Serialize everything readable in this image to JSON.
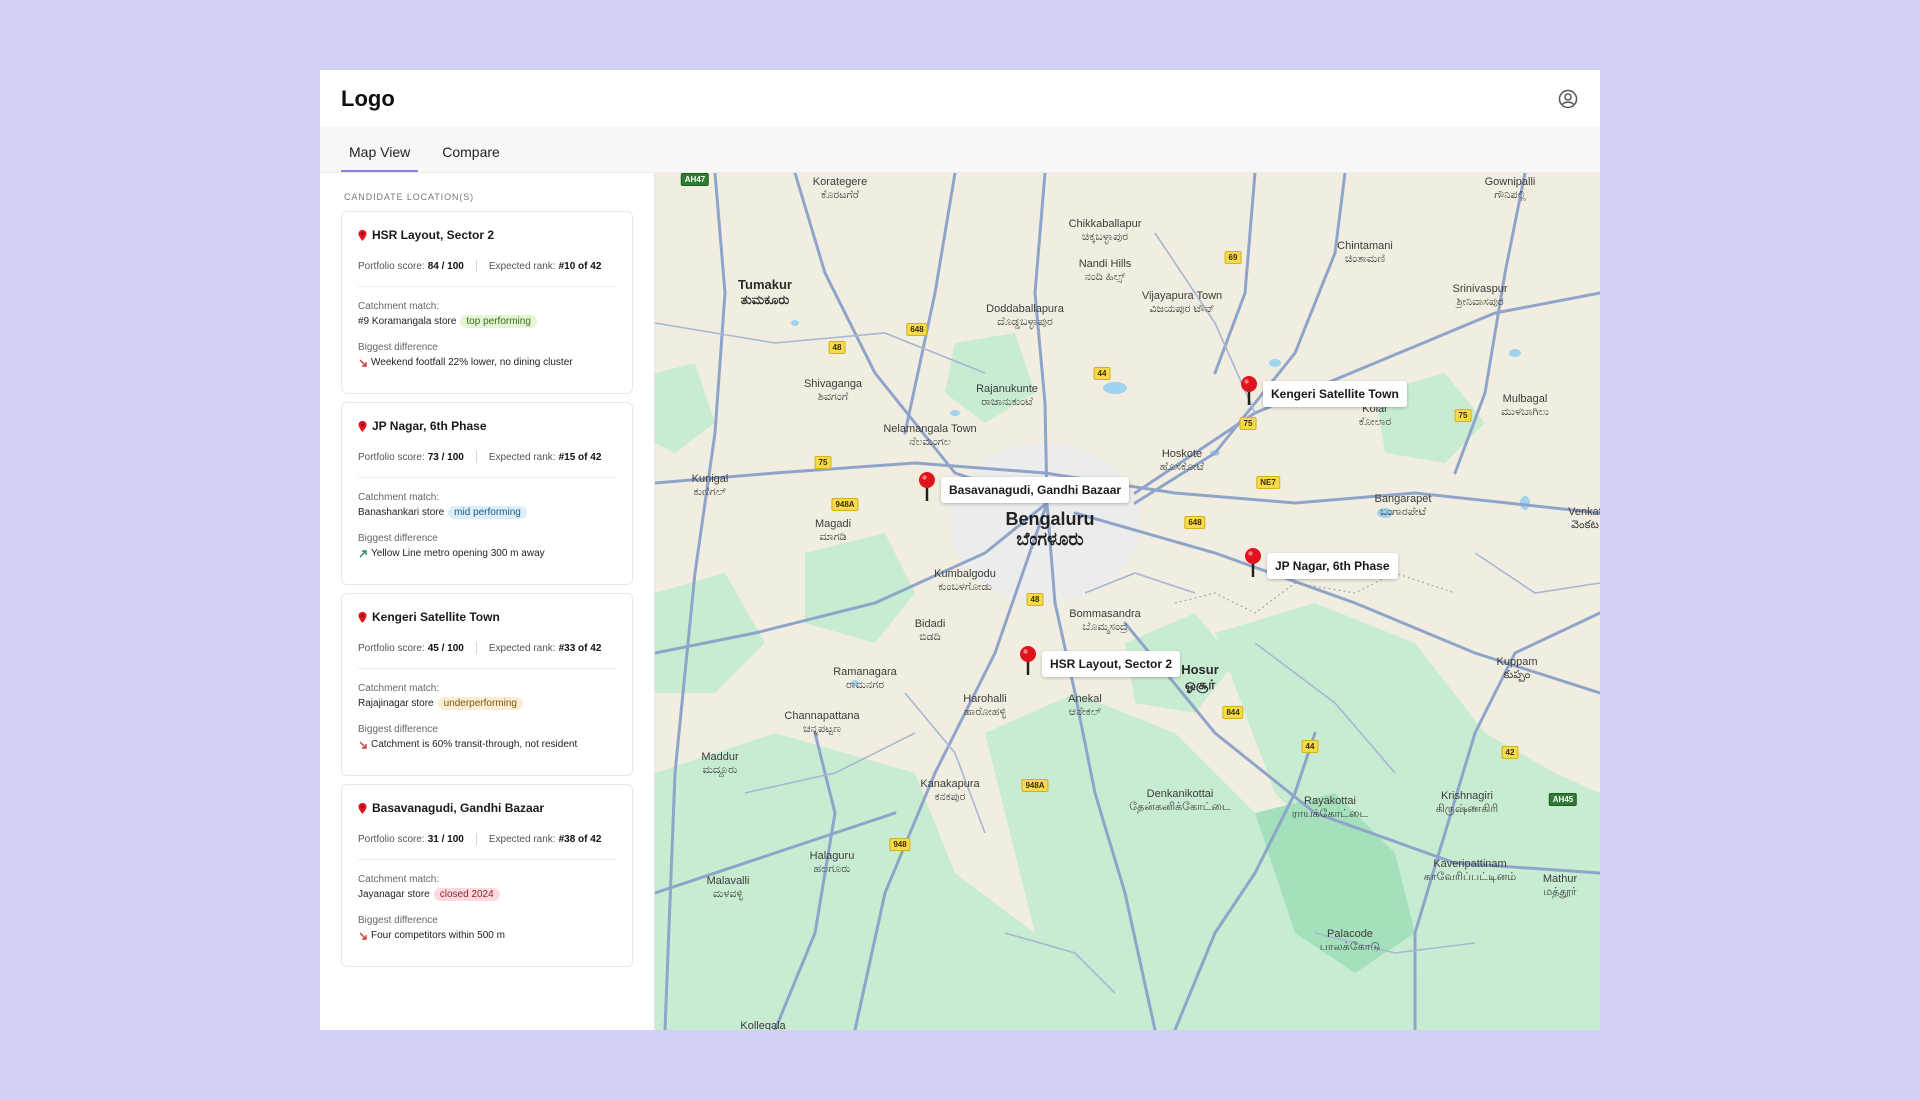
{
  "header": {
    "logo": "Logo",
    "user_icon": "user-circle-icon"
  },
  "tabs": [
    {
      "label": "Map View",
      "active": true
    },
    {
      "label": "Compare",
      "active": false
    }
  ],
  "sidebar": {
    "section_label": "CANDIDATE LOCATION(S)",
    "cards": [
      {
        "title": "HSR Layout, Sector 2",
        "score_label": "Portfolio score:",
        "score": "84 / 100",
        "rank_label": "Expected rank:",
        "rank": "#10 of 42",
        "match_label": "Catchment match:",
        "store": "#9 Koramangala store",
        "chip": "top performing",
        "chip_bg": "#e3f6d3",
        "chip_color": "#3b6b1e",
        "diff_label": "Biggest difference",
        "diff_dir": "down",
        "diff": "Weekend footfall 22% lower, no dining cluster"
      },
      {
        "title": "JP Nagar, 6th Phase",
        "score_label": "Portfolio score:",
        "score": "73 / 100",
        "rank_label": "Expected rank:",
        "rank": "#15 of 42",
        "match_label": "Catchment match:",
        "store": "Banashankari store",
        "chip": "mid performing",
        "chip_bg": "#dbeefa",
        "chip_color": "#245c83",
        "diff_label": "Biggest difference",
        "diff_dir": "up",
        "diff": "Yellow Line metro opening 300 m away"
      },
      {
        "title": "Kengeri Satellite Town",
        "score_label": "Portfolio score:",
        "score": "45 / 100",
        "rank_label": "Expected rank:",
        "rank": "#33 of 42",
        "match_label": "Catchment match:",
        "store": "Rajajinagar store",
        "chip": "underperforming",
        "chip_bg": "#fbeed3",
        "chip_color": "#7a5514",
        "diff_label": "Biggest difference",
        "diff_dir": "down",
        "diff": "Catchment is 60% transit-through, not resident"
      },
      {
        "title": "Basavanagudi, Gandhi Bazaar",
        "score_label": "Portfolio score:",
        "score": "31 / 100",
        "rank_label": "Expected rank:",
        "rank": "#38 of 42",
        "match_label": "Catchment match:",
        "store": "Jayanagar store",
        "chip": "closed 2024",
        "chip_bg": "#fbd9dc",
        "chip_color": "#8a2a33",
        "diff_label": "Biggest difference",
        "diff_dir": "down",
        "diff": "Four competitors within 500 m"
      }
    ]
  },
  "map": {
    "places": [
      {
        "name": "Bengaluru",
        "local": "ಬೆಂಗಳೂರು",
        "size": "big"
      },
      {
        "name": "Hosur",
        "local": "ஓசூர்",
        "size": "mid"
      },
      {
        "name": "Tumakur",
        "local": "ತುಮಕೂರು",
        "size": "mid"
      },
      {
        "name": "Chikkaballapur",
        "local": "ಚಿಕ್ಕಬಳ್ಳಾಪುರ"
      },
      {
        "name": "Nandi Hills",
        "local": "ನಂದಿ ಹಿಲ್ಸ್"
      },
      {
        "name": "Doddaballapura",
        "local": "ದೊಡ್ಡಬಳ್ಳಾಪುರ"
      },
      {
        "name": "Vijayapura Town",
        "local": "ವಿಜಯಪುರ ಟೌನ್"
      },
      {
        "name": "Chintamani",
        "local": "ಚಿಂತಾಮಣಿ"
      },
      {
        "name": "Gownipalli",
        "local": "ಗೌನಿಪಲ್ಲಿ"
      },
      {
        "name": "Srinivaspur",
        "local": "ಶ್ರೀನಿವಾಸಪುರ"
      },
      {
        "name": "Kolar",
        "local": "ಕೋಲಾರ"
      },
      {
        "name": "Mulbagal",
        "local": "ಮುಳಬಾಗಿಲು"
      },
      {
        "name": "Shivaganga",
        "local": "ಶಿವಗಂಗೆ"
      },
      {
        "name": "Rajanukunte",
        "local": "ರಾಜಾನುಕುಂಟೆ"
      },
      {
        "name": "Nelamangala Town",
        "local": "ನೆಲಮಂಗಲ"
      },
      {
        "name": "Hoskote",
        "local": "ಹೊಸಕೋಟೆ"
      },
      {
        "name": "Kunigal",
        "local": "ಕುಣಿಗಲ್"
      },
      {
        "name": "Magadi",
        "local": "ಮಾಗಡಿ"
      },
      {
        "name": "Bangarapet",
        "local": "ಬಂಗಾರಪೇಟೆ"
      },
      {
        "name": "Kumbalgodu",
        "local": "ಕುಂಬಳಗೋಡು"
      },
      {
        "name": "Bommasandra",
        "local": "ಬೊಮ್ಮಸಂದ್ರ"
      },
      {
        "name": "Bidadi",
        "local": "ಬಿಡದಿ"
      },
      {
        "name": "Ramanagara",
        "local": "ರಾಮನಗರ"
      },
      {
        "name": "Harohalli",
        "local": "ಹಾರೋಹಳ್ಳಿ"
      },
      {
        "name": "Anekal",
        "local": "ಆನೇಕಲ್"
      },
      {
        "name": "Channapattana",
        "local": "ಚನ್ನಪಟ್ಟಣ"
      },
      {
        "name": "Kuppam",
        "local": "కుప్పం"
      },
      {
        "name": "Maddur",
        "local": "ಮದ್ದೂರು"
      },
      {
        "name": "Kanakapura",
        "local": "ಕನಕಪುರ"
      },
      {
        "name": "Denkanikottai",
        "local": "தேன்கனிக்கோட்டை"
      },
      {
        "name": "Rayakottai",
        "local": "ராயக்கோட்டை"
      },
      {
        "name": "Krishnagiri",
        "local": "கிருஷ்ணகிரி"
      },
      {
        "name": "Halaguru",
        "local": "ಹಲಗೂರು"
      },
      {
        "name": "Kaveripattinam",
        "local": "காவேரிப்பட்டினம்"
      },
      {
        "name": "Malavalli",
        "local": "ಮಳವಳ್ಳಿ"
      },
      {
        "name": "Mathur",
        "local": "மத்தூர்"
      },
      {
        "name": "Palacode",
        "local": "பாலக்கோடு"
      },
      {
        "name": "Kollegala",
        "local": ""
      },
      {
        "name": "Korategere",
        "local": "ಕೊರಟಗೆರೆ"
      },
      {
        "name": "Venkat",
        "local": "వెంకట"
      }
    ],
    "shields": [
      "AH47",
      "69",
      "648",
      "48",
      "44",
      "75",
      "75",
      "NE7",
      "948A",
      "75",
      "648",
      "48",
      "844",
      "44",
      "42",
      "AH45",
      "948A",
      "948"
    ],
    "markers": [
      {
        "label": "Kengeri Satellite Town",
        "color": "#e0141e"
      },
      {
        "label": "Basavanagudi, Gandhi Bazaar",
        "color": "#e0141e"
      },
      {
        "label": "JP Nagar, 6th Phase",
        "color": "#e0141e"
      },
      {
        "label": "HSR Layout, Sector 2",
        "color": "#e0141e"
      }
    ]
  }
}
